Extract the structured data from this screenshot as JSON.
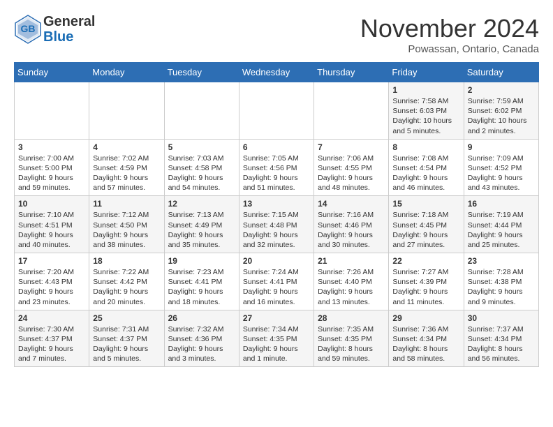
{
  "header": {
    "logo_general": "General",
    "logo_blue": "Blue",
    "month_title": "November 2024",
    "location": "Powassan, Ontario, Canada"
  },
  "weekdays": [
    "Sunday",
    "Monday",
    "Tuesday",
    "Wednesday",
    "Thursday",
    "Friday",
    "Saturday"
  ],
  "weeks": [
    [
      {
        "day": "",
        "info": ""
      },
      {
        "day": "",
        "info": ""
      },
      {
        "day": "",
        "info": ""
      },
      {
        "day": "",
        "info": ""
      },
      {
        "day": "",
        "info": ""
      },
      {
        "day": "1",
        "info": "Sunrise: 7:58 AM\nSunset: 6:03 PM\nDaylight: 10 hours\nand 5 minutes."
      },
      {
        "day": "2",
        "info": "Sunrise: 7:59 AM\nSunset: 6:02 PM\nDaylight: 10 hours\nand 2 minutes."
      }
    ],
    [
      {
        "day": "3",
        "info": "Sunrise: 7:00 AM\nSunset: 5:00 PM\nDaylight: 9 hours\nand 59 minutes."
      },
      {
        "day": "4",
        "info": "Sunrise: 7:02 AM\nSunset: 4:59 PM\nDaylight: 9 hours\nand 57 minutes."
      },
      {
        "day": "5",
        "info": "Sunrise: 7:03 AM\nSunset: 4:58 PM\nDaylight: 9 hours\nand 54 minutes."
      },
      {
        "day": "6",
        "info": "Sunrise: 7:05 AM\nSunset: 4:56 PM\nDaylight: 9 hours\nand 51 minutes."
      },
      {
        "day": "7",
        "info": "Sunrise: 7:06 AM\nSunset: 4:55 PM\nDaylight: 9 hours\nand 48 minutes."
      },
      {
        "day": "8",
        "info": "Sunrise: 7:08 AM\nSunset: 4:54 PM\nDaylight: 9 hours\nand 46 minutes."
      },
      {
        "day": "9",
        "info": "Sunrise: 7:09 AM\nSunset: 4:52 PM\nDaylight: 9 hours\nand 43 minutes."
      }
    ],
    [
      {
        "day": "10",
        "info": "Sunrise: 7:10 AM\nSunset: 4:51 PM\nDaylight: 9 hours\nand 40 minutes."
      },
      {
        "day": "11",
        "info": "Sunrise: 7:12 AM\nSunset: 4:50 PM\nDaylight: 9 hours\nand 38 minutes."
      },
      {
        "day": "12",
        "info": "Sunrise: 7:13 AM\nSunset: 4:49 PM\nDaylight: 9 hours\nand 35 minutes."
      },
      {
        "day": "13",
        "info": "Sunrise: 7:15 AM\nSunset: 4:48 PM\nDaylight: 9 hours\nand 32 minutes."
      },
      {
        "day": "14",
        "info": "Sunrise: 7:16 AM\nSunset: 4:46 PM\nDaylight: 9 hours\nand 30 minutes."
      },
      {
        "day": "15",
        "info": "Sunrise: 7:18 AM\nSunset: 4:45 PM\nDaylight: 9 hours\nand 27 minutes."
      },
      {
        "day": "16",
        "info": "Sunrise: 7:19 AM\nSunset: 4:44 PM\nDaylight: 9 hours\nand 25 minutes."
      }
    ],
    [
      {
        "day": "17",
        "info": "Sunrise: 7:20 AM\nSunset: 4:43 PM\nDaylight: 9 hours\nand 23 minutes."
      },
      {
        "day": "18",
        "info": "Sunrise: 7:22 AM\nSunset: 4:42 PM\nDaylight: 9 hours\nand 20 minutes."
      },
      {
        "day": "19",
        "info": "Sunrise: 7:23 AM\nSunset: 4:41 PM\nDaylight: 9 hours\nand 18 minutes."
      },
      {
        "day": "20",
        "info": "Sunrise: 7:24 AM\nSunset: 4:41 PM\nDaylight: 9 hours\nand 16 minutes."
      },
      {
        "day": "21",
        "info": "Sunrise: 7:26 AM\nSunset: 4:40 PM\nDaylight: 9 hours\nand 13 minutes."
      },
      {
        "day": "22",
        "info": "Sunrise: 7:27 AM\nSunset: 4:39 PM\nDaylight: 9 hours\nand 11 minutes."
      },
      {
        "day": "23",
        "info": "Sunrise: 7:28 AM\nSunset: 4:38 PM\nDaylight: 9 hours\nand 9 minutes."
      }
    ],
    [
      {
        "day": "24",
        "info": "Sunrise: 7:30 AM\nSunset: 4:37 PM\nDaylight: 9 hours\nand 7 minutes."
      },
      {
        "day": "25",
        "info": "Sunrise: 7:31 AM\nSunset: 4:37 PM\nDaylight: 9 hours\nand 5 minutes."
      },
      {
        "day": "26",
        "info": "Sunrise: 7:32 AM\nSunset: 4:36 PM\nDaylight: 9 hours\nand 3 minutes."
      },
      {
        "day": "27",
        "info": "Sunrise: 7:34 AM\nSunset: 4:35 PM\nDaylight: 9 hours\nand 1 minute."
      },
      {
        "day": "28",
        "info": "Sunrise: 7:35 AM\nSunset: 4:35 PM\nDaylight: 8 hours\nand 59 minutes."
      },
      {
        "day": "29",
        "info": "Sunrise: 7:36 AM\nSunset: 4:34 PM\nDaylight: 8 hours\nand 58 minutes."
      },
      {
        "day": "30",
        "info": "Sunrise: 7:37 AM\nSunset: 4:34 PM\nDaylight: 8 hours\nand 56 minutes."
      }
    ]
  ]
}
